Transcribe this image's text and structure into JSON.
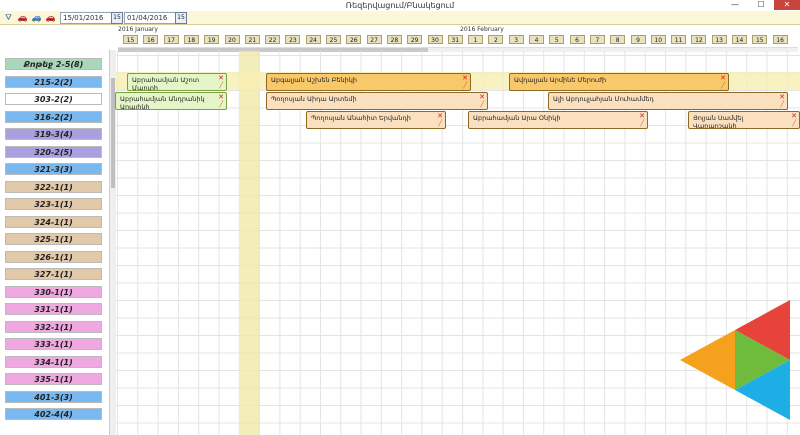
{
  "window": {
    "title": "Ռեզերվացում/Բնակեցում",
    "minimize": "—",
    "maximize": "☐",
    "close": "✕"
  },
  "toolbar": {
    "date_from": "15/01/2016",
    "date_to": "01/04/2016",
    "cal_label": "15"
  },
  "header": {
    "month1": "2016 January",
    "month2": "2016 February",
    "days": [
      "15",
      "16",
      "17",
      "18",
      "19",
      "20",
      "21",
      "22",
      "23",
      "24",
      "25",
      "26",
      "27",
      "28",
      "29",
      "30",
      "31",
      "1",
      "2",
      "3",
      "4",
      "5",
      "6",
      "7",
      "8",
      "9",
      "10",
      "11",
      "12",
      "13",
      "14",
      "15",
      "16"
    ]
  },
  "resources": [
    {
      "label": "Քոթեջ 2-5(8)",
      "color": "#a8d8b9"
    },
    {
      "label": "215-2(2)",
      "color": "#7ab8f0"
    },
    {
      "label": "303-2(2)",
      "color": "#ffffff"
    },
    {
      "label": "316-2(2)",
      "color": "#7ab8f0"
    },
    {
      "label": "319-3(4)",
      "color": "#a9a0e0"
    },
    {
      "label": "320-2(5)",
      "color": "#a9a0e0"
    },
    {
      "label": "321-3(3)",
      "color": "#7ab8f0"
    },
    {
      "label": "322-1(1)",
      "color": "#e2c9a9"
    },
    {
      "label": "323-1(1)",
      "color": "#e2c9a9"
    },
    {
      "label": "324-1(1)",
      "color": "#e2c9a9"
    },
    {
      "label": "325-1(1)",
      "color": "#e2c9a9"
    },
    {
      "label": "326-1(1)",
      "color": "#e2c9a9"
    },
    {
      "label": "327-1(1)",
      "color": "#e2c9a9"
    },
    {
      "label": "330-1(1)",
      "color": "#f0a8e0"
    },
    {
      "label": "331-1(1)",
      "color": "#f0a8e0"
    },
    {
      "label": "332-1(1)",
      "color": "#f0a8e0"
    },
    {
      "label": "333-1(1)",
      "color": "#f0a8e0"
    },
    {
      "label": "334-1(1)",
      "color": "#f0a8e0"
    },
    {
      "label": "335-1(1)",
      "color": "#f0a8e0"
    },
    {
      "label": "401-3(3)",
      "color": "#7ab8f0"
    },
    {
      "label": "402-4(4)",
      "color": "#7ab8f0"
    }
  ],
  "events": [
    {
      "text": "Աբրահամյան Աշոտ Մարտի",
      "type": "green"
    },
    {
      "text": "Աբգալյան Աշխեն Բենիկի",
      "type": "orange"
    },
    {
      "text": "Ավդալյան Արմինե Մերուժի",
      "type": "orange"
    },
    {
      "text": "Աբրահամյան Անդրանիկ Արայիկի",
      "type": "green"
    },
    {
      "text": "Պողոսյան Աիդա Արտեմի",
      "type": "peach"
    },
    {
      "text": "Ալի Աբդուլլահյան Մուհամմեդ",
      "type": "peach"
    },
    {
      "text": "Պողոսյան Անահիտ Երվանդի",
      "type": "peach"
    },
    {
      "text": "Աբրահամյան Արա Օնիկի",
      "type": "peach"
    },
    {
      "text": "Յոլյան Սամվել Վաղարշակի",
      "type": "peach"
    }
  ],
  "logo_colors": {
    "red": "#e8433a",
    "green": "#6fbb3b",
    "orange": "#f5a11d",
    "blue": "#1eaee6"
  }
}
